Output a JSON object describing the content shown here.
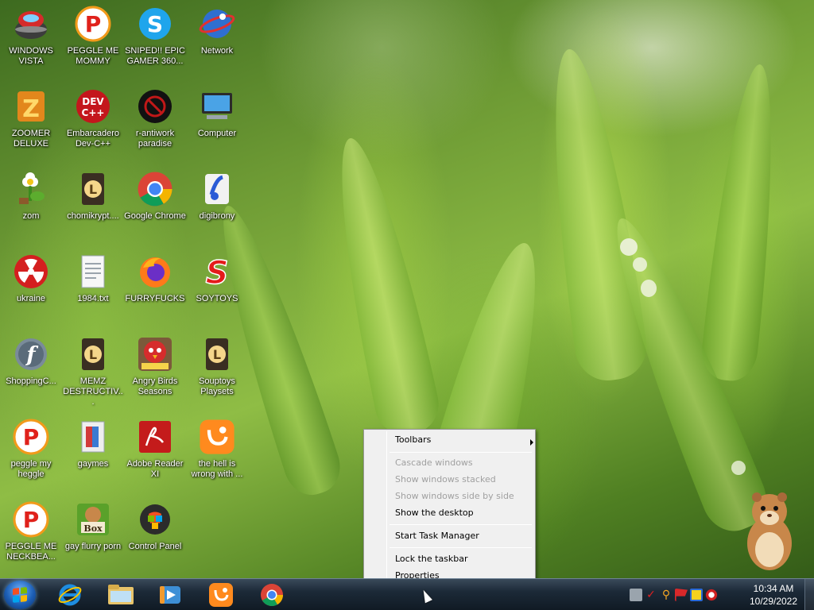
{
  "desktop": {
    "icons": [
      {
        "label": "WINDOWS VISTA",
        "icon": "vista-bowl-icon"
      },
      {
        "label": "PEGGLE ME MOMMY",
        "icon": "peggle-icon"
      },
      {
        "label": "SNIPED!! EPIC GAMER 360...",
        "icon": "skype-icon"
      },
      {
        "label": "Network",
        "icon": "network-globe-icon"
      },
      {
        "label": "ZOOMER DELUXE",
        "icon": "zuma-icon"
      },
      {
        "label": "Embarcadero Dev-C++",
        "icon": "devcpp-icon"
      },
      {
        "label": "r-antiwork paradise",
        "icon": "antiwork-icon"
      },
      {
        "label": "Computer",
        "icon": "computer-icon"
      },
      {
        "label": "zom",
        "icon": "flower-icon"
      },
      {
        "label": "chomikrypt....",
        "icon": "shortcut-l-icon"
      },
      {
        "label": "Google Chrome",
        "icon": "chrome-icon"
      },
      {
        "label": "digibrony",
        "icon": "digibrony-icon"
      },
      {
        "label": "ukraine",
        "icon": "radiation-icon"
      },
      {
        "label": "1984.txt",
        "icon": "text-file-icon"
      },
      {
        "label": "FURRYFUCKS",
        "icon": "firefox-icon"
      },
      {
        "label": "SOYTOYS",
        "icon": "soytoys-icon"
      },
      {
        "label": "ShoppingC...",
        "icon": "flash-icon"
      },
      {
        "label": "MEMZ DESTRUCTIV...",
        "icon": "shortcut-l-icon"
      },
      {
        "label": "Angry Birds Seasons",
        "icon": "angry-birds-icon"
      },
      {
        "label": "Souptoys Playsets",
        "icon": "shortcut-l-icon"
      },
      {
        "label": "peggle my heggle",
        "icon": "peggle-icon"
      },
      {
        "label": "gaymes",
        "icon": "games-folder-icon"
      },
      {
        "label": "Adobe Reader XI",
        "icon": "adobe-reader-icon"
      },
      {
        "label": "the hell is wrong with ...",
        "icon": "uc-browser-icon"
      },
      {
        "label": "PEGGLE ME NECKBEA...",
        "icon": "peggle-icon"
      },
      {
        "label": "gay flurry porn",
        "icon": "boxed-hamster-icon"
      },
      {
        "label": "Control Panel",
        "icon": "control-panel-icon"
      }
    ]
  },
  "context_menu": {
    "toolbars": "Toolbars",
    "cascade": "Cascade windows",
    "stacked": "Show windows stacked",
    "side_by_side": "Show windows side by side",
    "show_desktop": "Show the desktop",
    "task_manager": "Start Task Manager",
    "lock": "Lock the taskbar",
    "properties": "Properties"
  },
  "taskbar": {
    "pinned": [
      "internet-explorer-icon",
      "file-explorer-icon",
      "media-player-icon",
      "uc-browser-icon",
      "chrome-icon"
    ],
    "clock_time": "10:34 AM",
    "clock_date": "10/29/2022"
  }
}
